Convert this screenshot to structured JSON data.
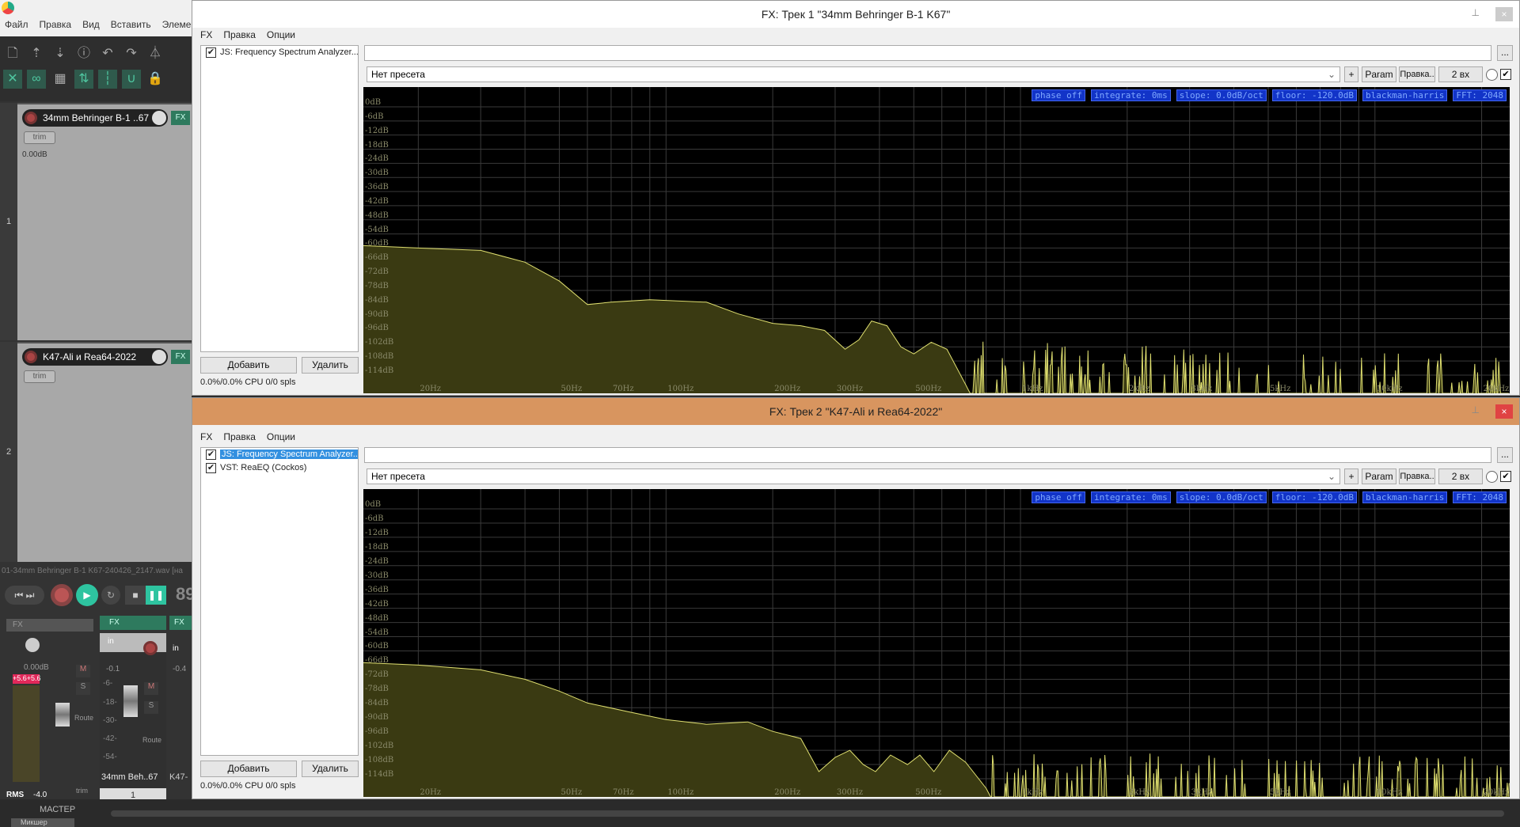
{
  "main_menu": [
    "Файл",
    "Правка",
    "Вид",
    "Вставить",
    "Элемен"
  ],
  "tracks": [
    {
      "num": "1",
      "name": "34mm Behringer B-1 ..67",
      "trim": "trim",
      "vol": "0.00dB",
      "fx": "FX"
    },
    {
      "num": "2",
      "name": "K47-Ali и Rea64-2022",
      "trim": "trim",
      "fx": "FX"
    }
  ],
  "transport": {
    "file": "01-34mm Behringer B-1 K67-240426_2147.wav [на",
    "time": "89"
  },
  "mixer": {
    "master_fx": "FX",
    "master_vol": "0.00dB",
    "peak_l": "+5.6",
    "peak_r": "+5.6",
    "rms_label": "RMS",
    "rms_value": "-4.0",
    "master_label": "МАСТЕР",
    "route": "Route",
    "trim": "trim",
    "ch1_fx": "FX",
    "ch1_in": "in",
    "ch1_vol": "-0.1",
    "ch1_name": "34mm Beh..67",
    "ch1_num": "1",
    "ch2_fx": "FX",
    "ch2_in": "in",
    "ch2_vol": "-0.4",
    "ch2_name": "K47-",
    "mute": "M",
    "solo": "S",
    "scale": [
      "-6-",
      "-18-",
      "-30-",
      "-42-",
      "-54-"
    ],
    "mixer_tab": "Микшер"
  },
  "windows": [
    {
      "title": "FX: Трек 1 \"34mm Behringer B-1 K67\"",
      "menu": [
        "FX",
        "Правка",
        "Опции"
      ],
      "fx_list": [
        {
          "label": "JS: Frequency Spectrum Analyzer...",
          "checked": true,
          "selected": false
        }
      ],
      "add": "Добавить",
      "remove": "Удалить",
      "cpu": "0.0%/0.0% CPU 0/0 spls",
      "preset": "Нет пресета",
      "plus": "+",
      "param": "Param",
      "edit": "Правка..",
      "inputs": "2 вх",
      "more": "...",
      "curve": [
        [
          14,
          -59
        ],
        [
          20,
          -60
        ],
        [
          30,
          -61
        ],
        [
          40,
          -66
        ],
        [
          50,
          -74
        ],
        [
          60,
          -84
        ],
        [
          70,
          -83
        ],
        [
          90,
          -82
        ],
        [
          130,
          -83
        ],
        [
          160,
          -88
        ],
        [
          200,
          -92
        ],
        [
          240,
          -93
        ],
        [
          280,
          -95
        ],
        [
          320,
          -103
        ],
        [
          350,
          -99
        ],
        [
          380,
          -91
        ],
        [
          420,
          -93
        ],
        [
          460,
          -102
        ],
        [
          500,
          -105
        ],
        [
          560,
          -100
        ],
        [
          620,
          -103
        ],
        [
          700,
          -118
        ]
      ]
    },
    {
      "title": "FX: Трек 2 \"K47-Ali и Rea64-2022\"",
      "menu": [
        "FX",
        "Правка",
        "Опции"
      ],
      "fx_list": [
        {
          "label": "JS: Frequency Spectrum Analyzer...",
          "checked": true,
          "selected": true
        },
        {
          "label": "VST: ReaEQ (Cockos)",
          "checked": true,
          "selected": false
        }
      ],
      "add": "Добавить",
      "remove": "Удалить",
      "cpu": "0.0%/0.0% CPU 0/0 spls",
      "preset": "Нет пресета",
      "plus": "+",
      "param": "Param",
      "edit": "Правка..",
      "inputs": "2 вх",
      "more": "...",
      "curve": [
        [
          14,
          -65
        ],
        [
          20,
          -66
        ],
        [
          30,
          -68
        ],
        [
          40,
          -72
        ],
        [
          50,
          -77
        ],
        [
          60,
          -82
        ],
        [
          80,
          -86
        ],
        [
          100,
          -89
        ],
        [
          130,
          -91
        ],
        [
          170,
          -90
        ],
        [
          200,
          -94
        ],
        [
          240,
          -97
        ],
        [
          270,
          -111
        ],
        [
          300,
          -105
        ],
        [
          330,
          -102
        ],
        [
          360,
          -108
        ],
        [
          390,
          -111
        ],
        [
          430,
          -104
        ],
        [
          480,
          -108
        ],
        [
          520,
          -104
        ],
        [
          570,
          -111
        ],
        [
          630,
          -102
        ],
        [
          700,
          -107
        ],
        [
          800,
          -118
        ]
      ]
    }
  ],
  "analyzer": {
    "params": [
      "phase off",
      "integrate: 0ms",
      "slope: 0.0dB/oct",
      "floor: -120.0dB",
      "blackman-harris",
      "FFT: 2048"
    ],
    "db_labels": [
      "0dB",
      "-6dB",
      "-12dB",
      "-18dB",
      "-24dB",
      "-30dB",
      "-36dB",
      "-42dB",
      "-48dB",
      "-54dB",
      "-60dB",
      "-66dB",
      "-72dB",
      "-78dB",
      "-84dB",
      "-90dB",
      "-96dB",
      "-102dB",
      "-108dB",
      "-114dB"
    ],
    "freq_labels": [
      [
        "20Hz",
        20
      ],
      [
        "50Hz",
        50
      ],
      [
        "70Hz",
        70
      ],
      [
        "100Hz",
        100
      ],
      [
        "200Hz",
        200
      ],
      [
        "300Hz",
        300
      ],
      [
        "500Hz",
        500
      ],
      [
        "1kHz",
        1000
      ],
      [
        "2kHz",
        2000
      ],
      [
        "3kHz",
        3000
      ],
      [
        "5kHz",
        5000
      ],
      [
        "10kHz",
        10000
      ],
      [
        "20kHz",
        20000
      ]
    ],
    "freq_range": [
      14,
      24000
    ],
    "db_range": [
      -120,
      1.5
    ],
    "colors": {
      "line": "#e0e070",
      "fill": "#3a3a12",
      "grid": "#3a3a3a",
      "param_bg": "#1234c8"
    }
  },
  "colors": {
    "active_title": "#d8955f",
    "accent": "#2ec4a0"
  }
}
